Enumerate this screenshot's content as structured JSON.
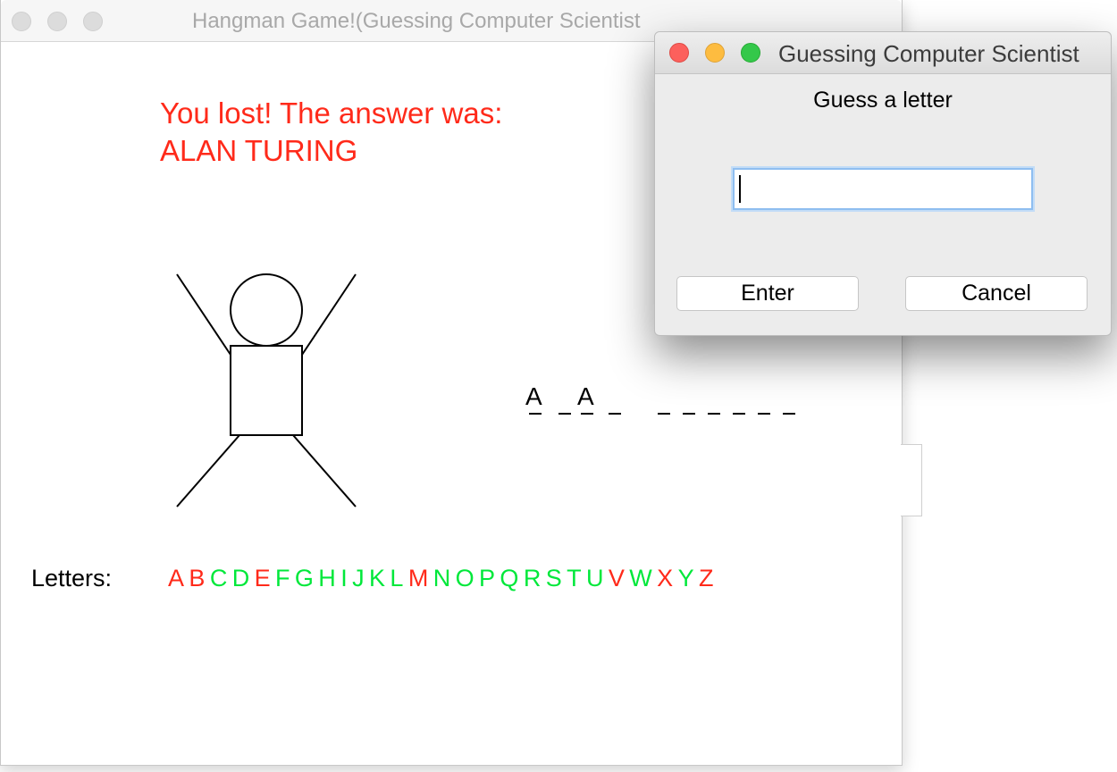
{
  "main_window": {
    "title": "Hangman Game!(Guessing Computer Scientist",
    "status_line1": "You lost! The answer was:",
    "status_line2": "ALAN TURING",
    "revealed_word": [
      "A",
      "",
      "A",
      "",
      "",
      "",
      "",
      "",
      "",
      "",
      ""
    ],
    "letters_label": "Letters:",
    "letters": [
      {
        "ch": "A",
        "state": "wrong"
      },
      {
        "ch": "B",
        "state": "wrong"
      },
      {
        "ch": "C",
        "state": "available"
      },
      {
        "ch": "D",
        "state": "available"
      },
      {
        "ch": "E",
        "state": "wrong"
      },
      {
        "ch": "F",
        "state": "available"
      },
      {
        "ch": "G",
        "state": "available"
      },
      {
        "ch": "H",
        "state": "available"
      },
      {
        "ch": "I",
        "state": "available"
      },
      {
        "ch": "J",
        "state": "available"
      },
      {
        "ch": "K",
        "state": "available"
      },
      {
        "ch": "L",
        "state": "available"
      },
      {
        "ch": "M",
        "state": "wrong"
      },
      {
        "ch": "N",
        "state": "available"
      },
      {
        "ch": "O",
        "state": "available"
      },
      {
        "ch": "P",
        "state": "available"
      },
      {
        "ch": "Q",
        "state": "available"
      },
      {
        "ch": "R",
        "state": "available"
      },
      {
        "ch": "S",
        "state": "available"
      },
      {
        "ch": "T",
        "state": "available"
      },
      {
        "ch": "U",
        "state": "available"
      },
      {
        "ch": "V",
        "state": "wrong"
      },
      {
        "ch": "W",
        "state": "available"
      },
      {
        "ch": "X",
        "state": "wrong"
      },
      {
        "ch": "Y",
        "state": "available"
      },
      {
        "ch": "Z",
        "state": "wrong"
      }
    ]
  },
  "dialog": {
    "title": "Guessing Computer Scientist",
    "prompt": "Guess a letter",
    "input_value": "",
    "enter_label": "Enter",
    "cancel_label": "Cancel"
  },
  "colors": {
    "wrong": "#ff2a1a",
    "available": "#00e83a",
    "status": "#ff2a1a",
    "close": "#fc605c",
    "minimize": "#fdbc40",
    "zoom": "#34c84a"
  }
}
